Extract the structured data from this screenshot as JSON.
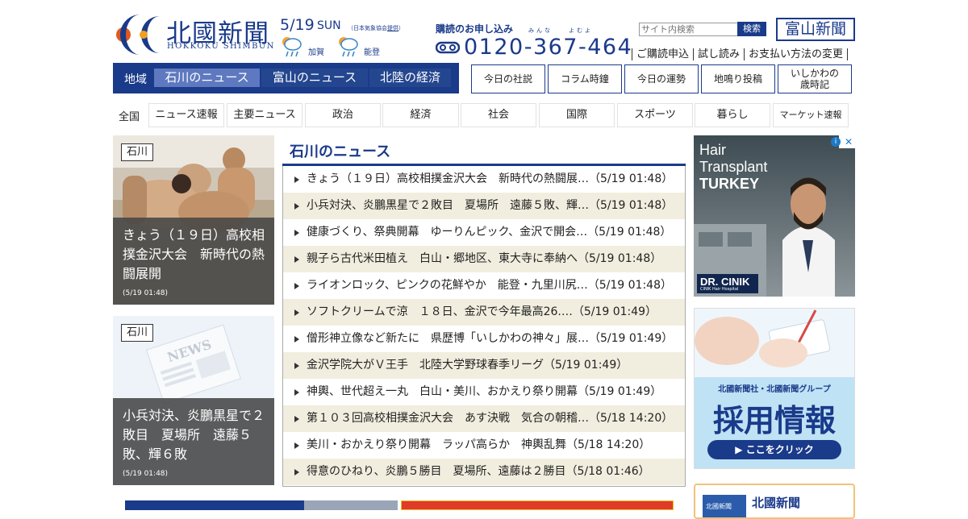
{
  "header": {
    "logo_kanji": "北國新聞",
    "logo_roman": "HOKKOKU SHIMBUN",
    "date": "5/19",
    "weekday": "SUN",
    "weather_credit_prefix": "（日本気象協会",
    "weather_credit_link": "提供",
    "weather_credit_suffix": "）",
    "weather": [
      {
        "area": "加賀",
        "icon": "cloudy-rain-icon"
      },
      {
        "area": "能登",
        "icon": "cloudy-rain-icon"
      }
    ],
    "subscription_label": "購読のお申し込み",
    "subscription_ruby": "みんな　　よむよ",
    "phone": "0120-367-464",
    "sub_links": [
      "ご購読申込",
      "試し読み",
      "お支払い方法の変更"
    ],
    "search_placeholder": "サイト内検索",
    "search_button": "検索",
    "toyama_button": "富山新聞"
  },
  "region_nav": {
    "label": "地域",
    "tabs": [
      "石川のニュース",
      "富山のニュース",
      "北陸の経済"
    ],
    "active": 0
  },
  "box_buttons": [
    "今日の社説",
    "コラム時鐘",
    "今日の運勢",
    "地鳴り投稿",
    "いしかわの\n歳時記"
  ],
  "category_nav": {
    "label": "全国",
    "tabs": [
      "ニュース速報",
      "主要ニュース",
      "政治",
      "経済",
      "社会",
      "国際",
      "スポーツ",
      "暮らし",
      "マーケット速報"
    ]
  },
  "featured": [
    {
      "badge": "石川",
      "title": "きょう（１９日）高校相撲金沢大会　新時代の熱闘展開",
      "time": "(5/19 01:48)"
    },
    {
      "badge": "石川",
      "title": "小兵対決、炎鵬黒星で２敗目　夏場所　遠藤５敗、輝６敗",
      "time": "(5/19 01:48)"
    }
  ],
  "news": {
    "heading": "石川のニュース",
    "items": [
      "きょう（１９日）高校相撲金沢大会　新時代の熱闘展…（5/19 01:48）",
      "小兵対決、炎鵬黒星で２敗目　夏場所　遠藤５敗、輝…（5/19 01:48）",
      "健康づくり、祭典開幕　ゆーりんピック、金沢で開会…（5/19 01:48）",
      "親子ら古代米田植え　白山・郷地区、東大寺に奉納へ（5/19 01:48）",
      "ライオンロック、ピンクの花鮮やか　能登・九里川尻…（5/19 01:48）",
      "ソフトクリームで涼　１８日、金沢で今年最高26.…（5/19 01:49）",
      "僧形神立像など新たに　県歴博「いしかわの神々」展…（5/19 01:49）",
      "金沢学院大がＶ王手　北陸大学野球春季リーグ（5/19 01:49）",
      "神輿、世代超え一丸　白山・美川、おかえり祭り開幕（5/19 01:49）",
      "第１０３回高校相撲金沢大会　あす決戦　気合の朝稽…（5/18 14:20）",
      "美川・おかえり祭り開幕　ラッパ高らか　神輿乱舞（5/18 14:20）",
      "得意のひねり、炎鵬５勝目　夏場所、遠藤は２勝目（5/18 01:46）"
    ]
  },
  "ads": {
    "hair": {
      "line1": "Hair",
      "line2": "Transplant",
      "line3": "TURKEY",
      "brand": "DR. CINIK",
      "sub": "CINIK Hair Hospital"
    },
    "recruit": {
      "company": "北國新聞社・北國新聞グループ",
      "title": "採用情報",
      "cta": "▶ ここをクリック"
    },
    "bottom": {
      "logo": "北國新聞",
      "text": "北國新聞"
    }
  },
  "colors": {
    "brand": "#1a3a8a",
    "alt_row": "#f1eedf",
    "active_tab": "#5e79bf"
  }
}
